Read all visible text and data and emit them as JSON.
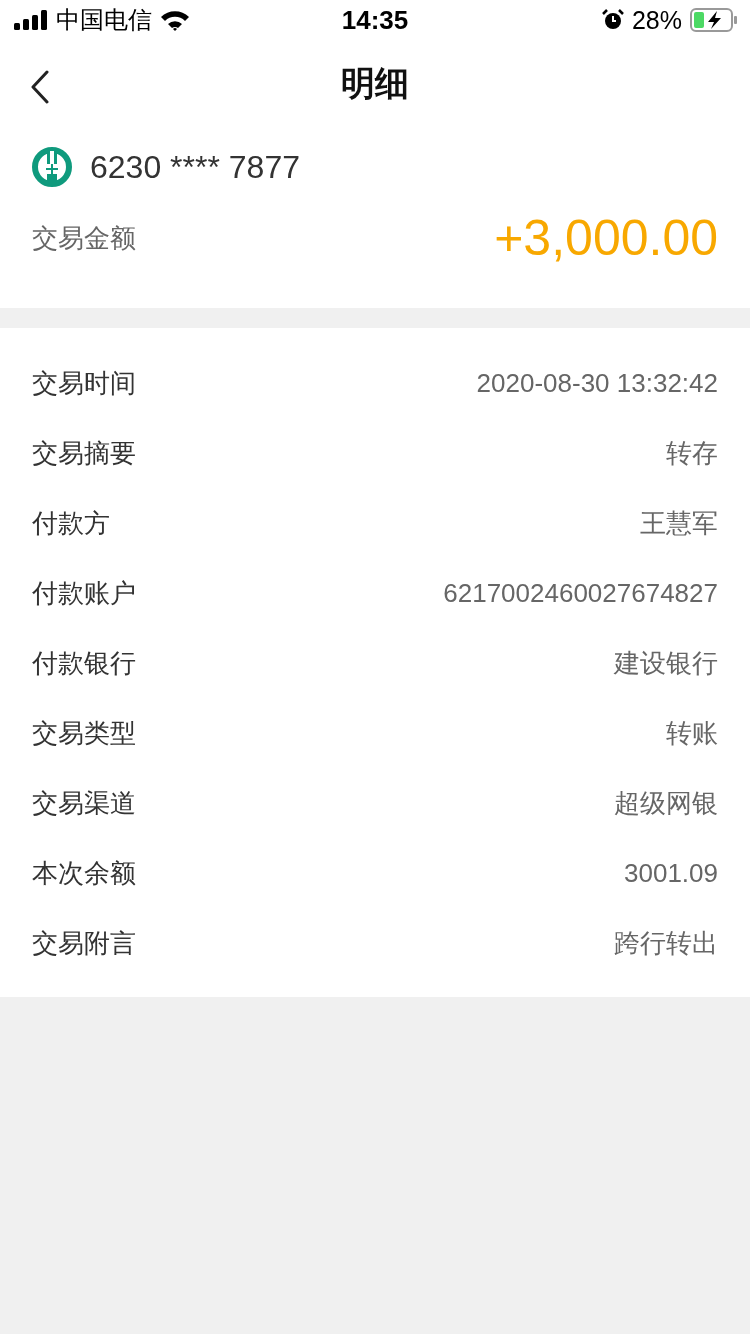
{
  "status_bar": {
    "carrier": "中国电信",
    "time": "14:35",
    "battery": "28%"
  },
  "nav": {
    "title": "明细"
  },
  "account": {
    "number": "6230 **** 7877",
    "amount_label": "交易金额",
    "amount": "+3,000.00"
  },
  "details": [
    {
      "label": "交易时间",
      "value": "2020-08-30 13:32:42"
    },
    {
      "label": "交易摘要",
      "value": "转存"
    },
    {
      "label": "付款方",
      "value": "王慧军"
    },
    {
      "label": "付款账户",
      "value": "6217002460027674827"
    },
    {
      "label": "付款银行",
      "value": "建设银行"
    },
    {
      "label": "交易类型",
      "value": "转账"
    },
    {
      "label": "交易渠道",
      "value": "超级网银"
    },
    {
      "label": "本次余额",
      "value": "3001.09"
    },
    {
      "label": "交易附言",
      "value": "跨行转出"
    }
  ]
}
